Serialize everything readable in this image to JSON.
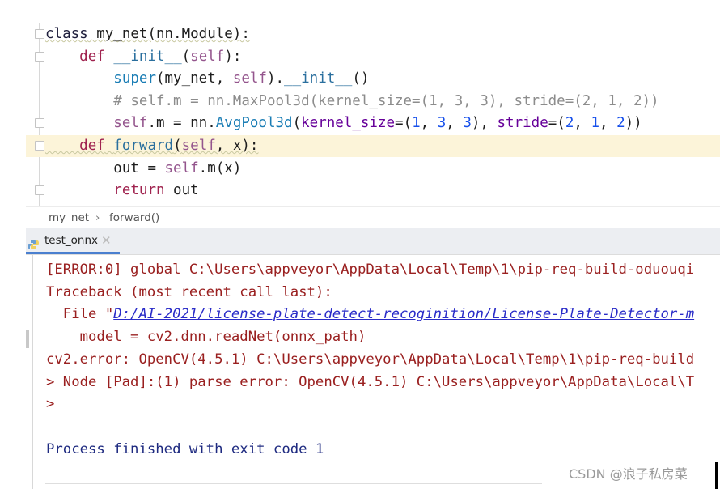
{
  "editor": {
    "lines": [
      [
        [
          "class",
          "kwc"
        ],
        [
          " my_net(nn.Module):",
          "pl"
        ]
      ],
      [
        [
          "    ",
          ""
        ],
        [
          "def",
          "kw"
        ],
        [
          " ",
          "pl"
        ],
        [
          "__init__",
          "fn"
        ],
        [
          "(",
          "pl"
        ],
        [
          "self",
          "self"
        ],
        [
          "):",
          "pl"
        ]
      ],
      [
        [
          "        ",
          ""
        ],
        [
          "super",
          "bi"
        ],
        [
          "(my_net, ",
          "pl"
        ],
        [
          "self",
          "self"
        ],
        [
          ").",
          "pl"
        ],
        [
          "__init__",
          "fn"
        ],
        [
          "()",
          "pl"
        ]
      ],
      [
        [
          "        ",
          ""
        ],
        [
          "# self.m = nn.MaxPool3d(kernel_size=(1, 3, 3), stride=(2, 1, 2))",
          "cm"
        ]
      ],
      [
        [
          "        ",
          ""
        ],
        [
          "self",
          "self"
        ],
        [
          ".m = nn.",
          "pl"
        ],
        [
          "AvgPool3d",
          "bi"
        ],
        [
          "(",
          "pl"
        ],
        [
          "kernel_size",
          "kwa"
        ],
        [
          "=(",
          "pl"
        ],
        [
          "1",
          "num"
        ],
        [
          ", ",
          "pl"
        ],
        [
          "3",
          "num"
        ],
        [
          ", ",
          "pl"
        ],
        [
          "3",
          "num"
        ],
        [
          "), ",
          "pl"
        ],
        [
          "stride",
          "kwa"
        ],
        [
          "=(",
          "pl"
        ],
        [
          "2",
          "num"
        ],
        [
          ", ",
          "pl"
        ],
        [
          "1",
          "num"
        ],
        [
          ", ",
          "pl"
        ],
        [
          "2",
          "num"
        ],
        [
          "))",
          "pl"
        ]
      ],
      [
        [
          "    ",
          ""
        ],
        [
          "def",
          "kw"
        ],
        [
          " ",
          "pl"
        ],
        [
          "forward",
          "fn"
        ],
        [
          "(",
          "pl"
        ],
        [
          "self",
          "self"
        ],
        [
          ", x):",
          "pl"
        ]
      ],
      [
        [
          "        ",
          ""
        ],
        [
          "out = ",
          "pl"
        ],
        [
          "self",
          "self"
        ],
        [
          ".m(x)",
          "pl"
        ]
      ],
      [
        [
          "        ",
          ""
        ],
        [
          "return",
          "kw"
        ],
        [
          " out",
          "pl"
        ]
      ]
    ],
    "highlighted_line": 6
  },
  "breadcrumb": {
    "items": [
      "my_net",
      "forward()"
    ],
    "separator": "›"
  },
  "run_tab": {
    "label": "test_onnx",
    "icon": "python-icon",
    "close_icon": "close-icon"
  },
  "console": {
    "lines": [
      {
        "text": "[ERROR:0] global C:\\Users\\appveyor\\AppData\\Local\\Temp\\1\\pip-req-build-oduouqi",
        "style": "err"
      },
      {
        "text": "Traceback (most recent call last):",
        "style": "err"
      },
      {
        "prefix": "  File \"",
        "link": "D:/AI-2021/license-plate-detect-recoginition/License-Plate-Detector-m",
        "style": "err"
      },
      {
        "text": "    model = cv2.dnn.readNet(onnx_path)",
        "style": "err"
      },
      {
        "text": "cv2.error: OpenCV(4.5.1) C:\\Users\\appveyor\\AppData\\Local\\Temp\\1\\pip-req-build",
        "style": "err"
      },
      {
        "text": "> Node [Pad]:(1) parse error: OpenCV(4.5.1) C:\\Users\\appveyor\\AppData\\Local\\T",
        "style": "err"
      },
      {
        "text": ">",
        "style": "err"
      },
      {
        "text": "",
        "style": "err"
      },
      {
        "text": "Process finished with exit code 1",
        "style": "done"
      }
    ]
  },
  "watermark": "CSDN @浪子私房菜",
  "colors": {
    "highlight": "#fcf4d9",
    "error_text": "#9a2020",
    "link": "#2a2cc8",
    "tab_underline": "#4a7fcf"
  }
}
